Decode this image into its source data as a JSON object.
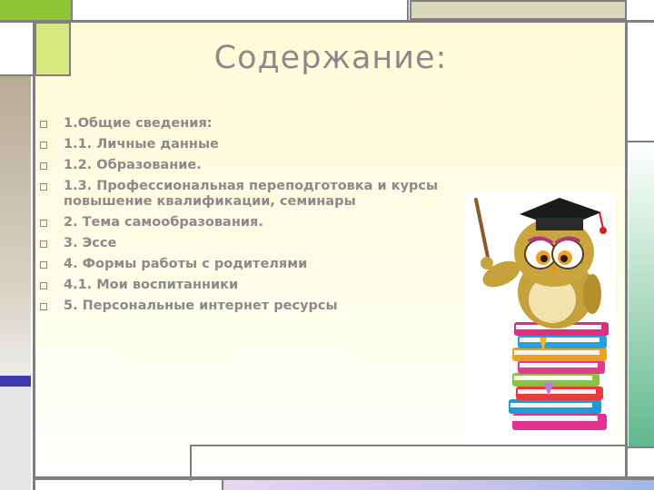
{
  "slide": {
    "title": "Содержание:",
    "items": [
      "1.Общие сведения:",
      "1.1. Личные данные",
      "1.2. Образование.",
      "1.3. Профессиональная переподготовка и курсы повышение квалификации, семинары",
      "2. Тема самообразования.",
      "3. Эссе",
      "4. Формы работы с родителями",
      "4.1. Мои воспитанники",
      "5. Персональные интернет ресурсы"
    ]
  },
  "decor": {
    "illustration": "owl-on-books",
    "colors": {
      "lime": "#8fc436",
      "khaki": "#c9cba0",
      "tan": "#b7aa95",
      "navy": "#3d3db0",
      "teal": "#5fb88e",
      "title_gray": "#8a8a8a"
    }
  }
}
